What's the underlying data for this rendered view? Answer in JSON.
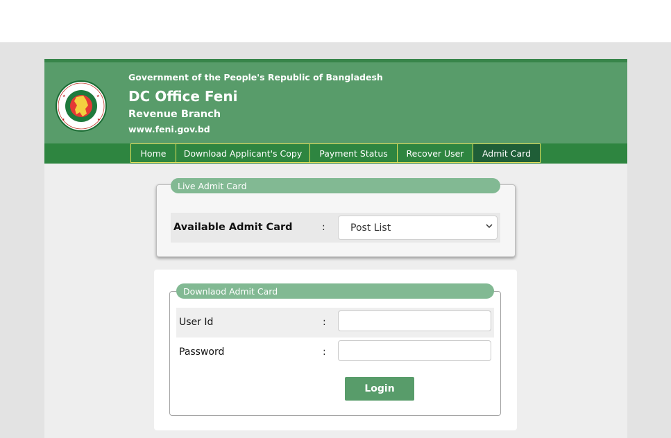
{
  "header": {
    "gov_line": "Government of the People's Republic of Bangladesh",
    "office": "DC Office Feni",
    "branch": "Revenue Branch",
    "website": "www.feni.gov.bd"
  },
  "nav": {
    "items": [
      {
        "label": "Home"
      },
      {
        "label": "Download Applicant's Copy"
      },
      {
        "label": "Payment Status"
      },
      {
        "label": "Recover User"
      },
      {
        "label": "Admit Card"
      }
    ],
    "active": "Admit Card"
  },
  "live_admit": {
    "legend": "Live Admit Card",
    "label": "Available Admit Card",
    "separator": ":",
    "select_value": "Post List"
  },
  "download_admit": {
    "legend": "Downlaod Admit Card",
    "user_id_label": "User Id",
    "password_label": "Password",
    "separator": ":",
    "user_id_value": "",
    "password_value": "",
    "login_label": "Login"
  },
  "colors": {
    "header_green": "#589c6a",
    "nav_green": "#2e8540",
    "legend_green": "#82b993",
    "nav_border": "#e4e05a"
  }
}
